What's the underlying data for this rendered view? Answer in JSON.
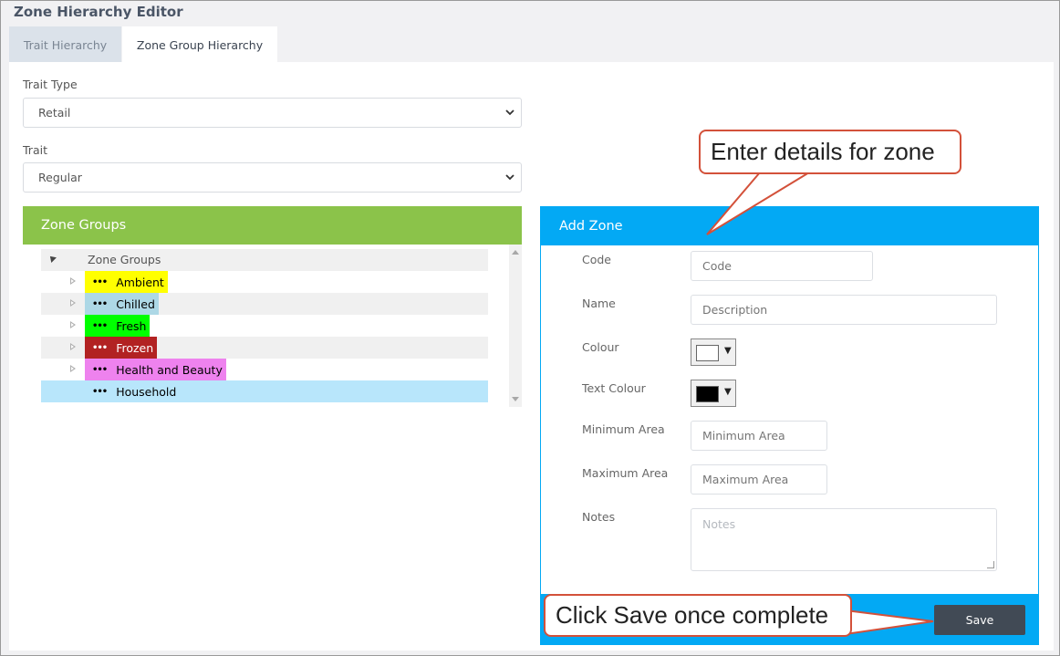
{
  "window": {
    "title": "Zone Hierarchy Editor"
  },
  "tabs": [
    {
      "label": "Trait Hierarchy",
      "active": false
    },
    {
      "label": "Zone Group Hierarchy",
      "active": true
    }
  ],
  "filters": {
    "trait_type": {
      "label": "Trait Type",
      "value": "Retail"
    },
    "trait": {
      "label": "Trait",
      "value": "Regular"
    }
  },
  "zone_groups": {
    "header": "Zone Groups",
    "root_label": "Zone Groups",
    "items": [
      {
        "label": "Ambient",
        "bg": "#ffff00",
        "fg": "#000000"
      },
      {
        "label": "Chilled",
        "bg": "#add8e6",
        "fg": "#000000"
      },
      {
        "label": "Fresh",
        "bg": "#00ff00",
        "fg": "#000000"
      },
      {
        "label": "Frozen",
        "bg": "#b22222",
        "fg": "#ffffff"
      },
      {
        "label": "Health and Beauty",
        "bg": "#ee82ee",
        "fg": "#000000"
      },
      {
        "label": "Household",
        "bg": "#b8e6fb",
        "fg": "#000000"
      }
    ]
  },
  "add_zone": {
    "header": "Add Zone",
    "fields": {
      "code": {
        "label": "Code",
        "placeholder": "Code"
      },
      "name": {
        "label": "Name",
        "placeholder": "Description"
      },
      "colour": {
        "label": "Colour",
        "value": "#ffffff"
      },
      "text_colour": {
        "label": "Text Colour",
        "value": "#000000"
      },
      "min_area": {
        "label": "Minimum Area",
        "placeholder": "Minimum Area"
      },
      "max_area": {
        "label": "Maximum Area",
        "placeholder": "Maximum Area"
      },
      "notes": {
        "label": "Notes",
        "placeholder": "Notes"
      }
    },
    "save_label": "Save"
  },
  "callouts": {
    "top": "Enter details for zone",
    "bottom": "Click Save once complete"
  },
  "colors": {
    "zone_groups_header": "#8bc34a",
    "add_zone_header": "#03a9f4",
    "callout_border": "#d3513a",
    "save_button": "#414a55"
  }
}
